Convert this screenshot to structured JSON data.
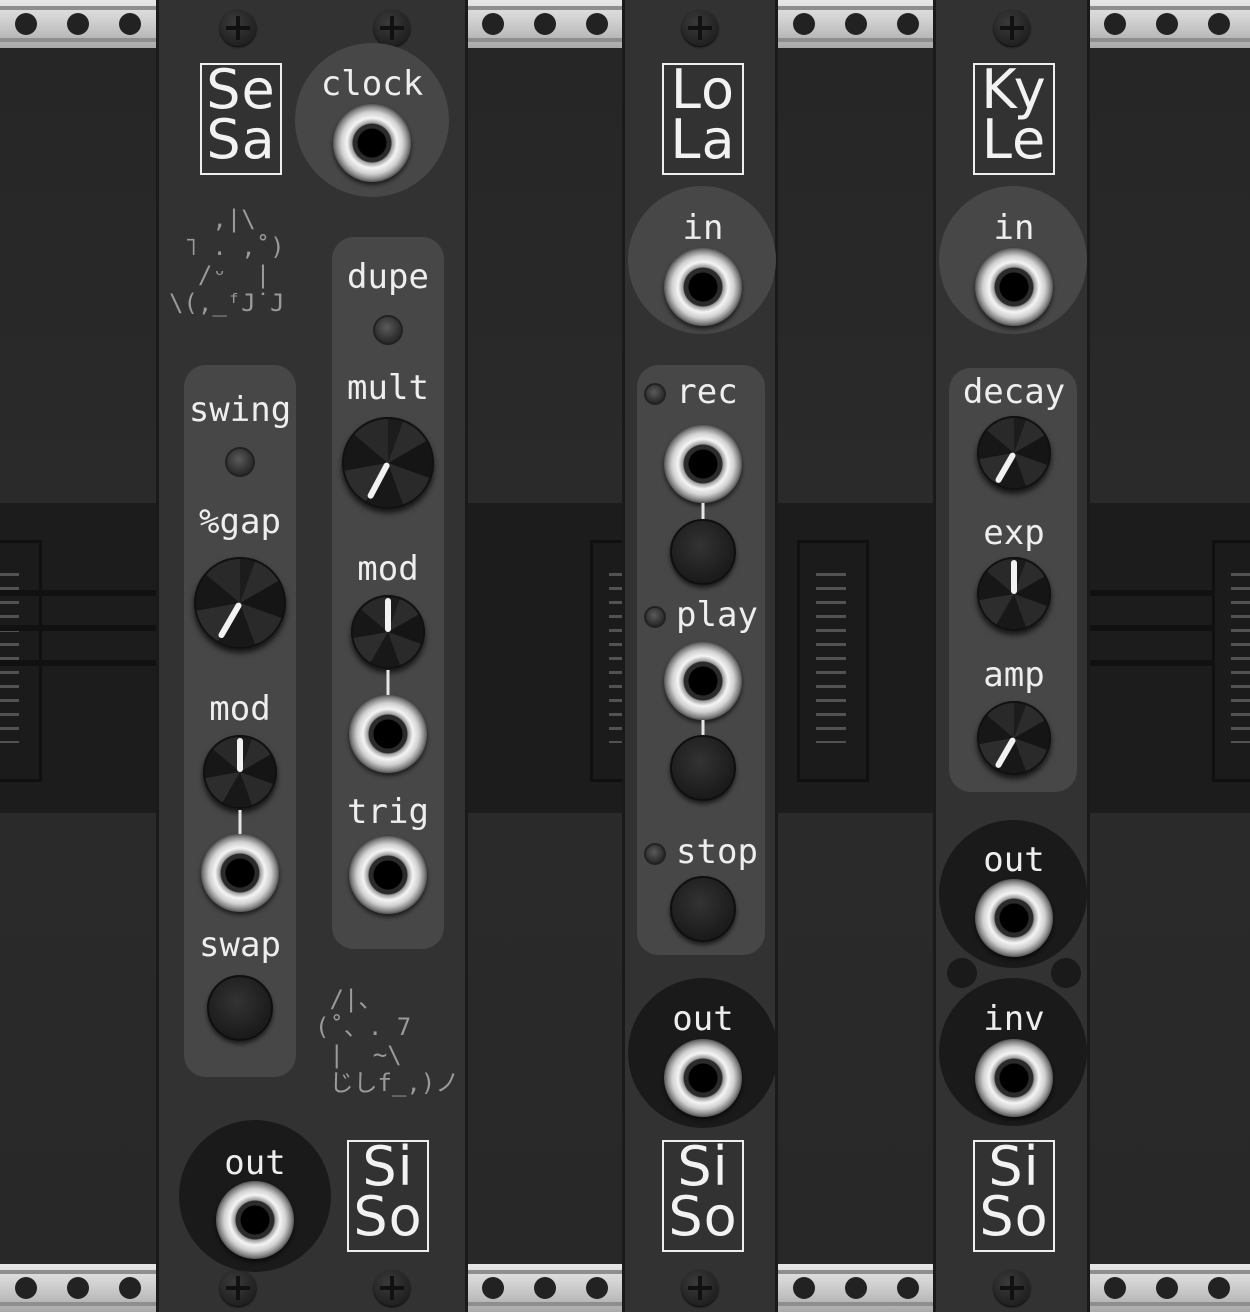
{
  "sesa": {
    "logo_line1": "Se",
    "logo_line2": "Sa",
    "clock_label": "clock",
    "swing_label": "swing",
    "gap_label": "%gap",
    "mod_left_label": "mod",
    "swap_label": "swap",
    "dupe_label": "dupe",
    "mult_label": "mult",
    "mod_right_label": "mod",
    "trig_label": "trig",
    "out_label": "out",
    "brand_line1": "Si",
    "brand_line2": "So",
    "ascii_top": "   ,|\\\n ˥ . ,˚)\n  /ᵕ  |\n\\(,_ᶠJ˙J",
    "ascii_bottom": " /|、\n(˚、. 7\n |  ~\\\n じしf_,)ノ"
  },
  "lola": {
    "logo_line1": "Lo",
    "logo_line2": "La",
    "in_label": "in",
    "rec_label": "rec",
    "play_label": "play",
    "stop_label": "stop",
    "out_label": "out",
    "brand_line1": "Si",
    "brand_line2": "So"
  },
  "kyle": {
    "logo_line1": "Ky",
    "logo_line2": "Le",
    "in_label": "in",
    "decay_label": "decay",
    "exp_label": "exp",
    "amp_label": "amp",
    "out_label": "out",
    "inv_label": "inv",
    "brand_line1": "Si",
    "brand_line2": "So"
  }
}
